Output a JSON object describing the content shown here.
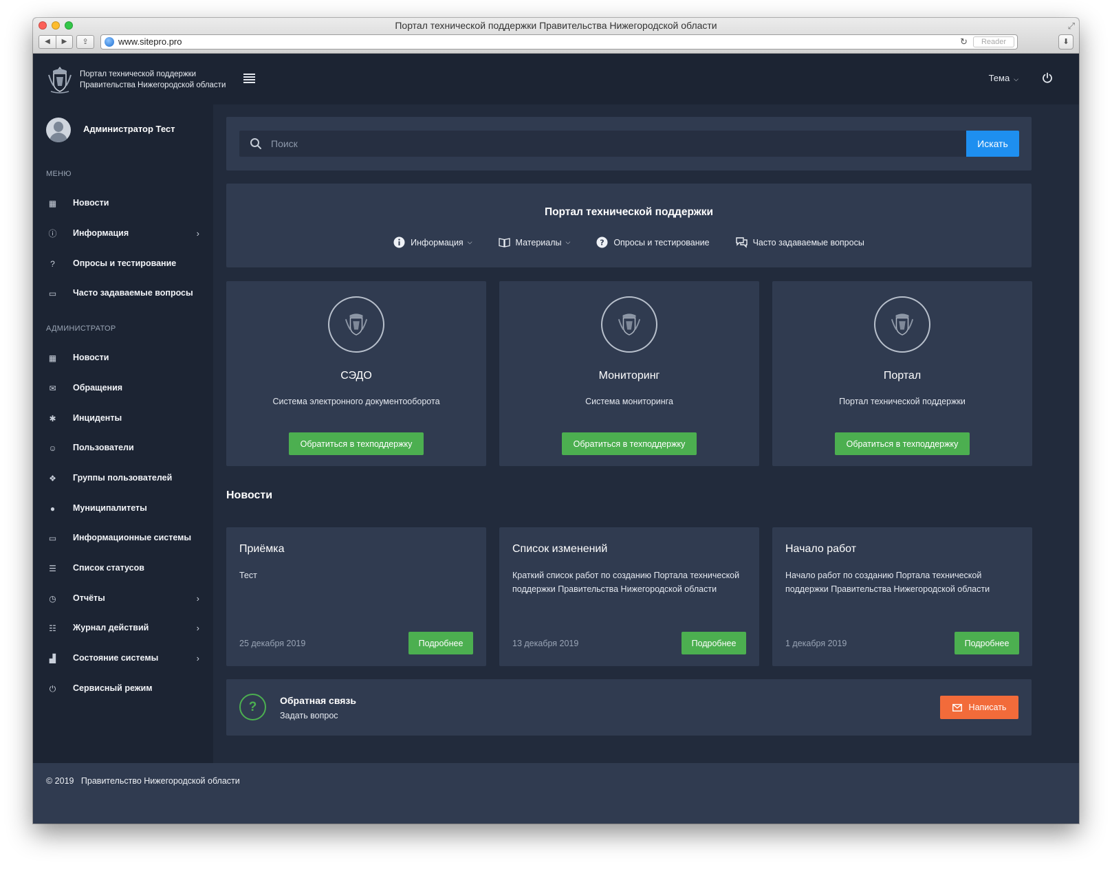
{
  "browser": {
    "window_title": "Портал технической поддержки Правительства Нижегородской области",
    "url": "www.sitepro.pro",
    "reader_label": "Reader"
  },
  "header": {
    "logo_line1": "Портал технической поддержки",
    "logo_line2": "Правительства Нижегородской области",
    "theme_label": "Тема"
  },
  "sidebar": {
    "user_name": "Администратор Тест",
    "menu_label": "МЕНЮ",
    "menu_items": [
      {
        "label": "Новости",
        "icon": "newspaper-icon"
      },
      {
        "label": "Информация",
        "icon": "info-icon",
        "has_submenu": true
      },
      {
        "label": "Опросы и тестирование",
        "icon": "question-icon"
      },
      {
        "label": "Часто задаваемые вопросы",
        "icon": "chat-icon"
      }
    ],
    "admin_label": "АДМИНИСТРАТОР",
    "admin_items": [
      {
        "label": "Новости",
        "icon": "newspaper-icon"
      },
      {
        "label": "Обращения",
        "icon": "envelope-icon"
      },
      {
        "label": "Инциденты",
        "icon": "bug-icon"
      },
      {
        "label": "Пользователи",
        "icon": "user-icon"
      },
      {
        "label": "Группы пользователей",
        "icon": "users-icon"
      },
      {
        "label": "Муниципалитеты",
        "icon": "globe-icon"
      },
      {
        "label": "Информационные системы",
        "icon": "monitor-icon"
      },
      {
        "label": "Список статусов",
        "icon": "list-icon"
      },
      {
        "label": "Отчёты",
        "icon": "clock-icon",
        "has_submenu": true
      },
      {
        "label": "Журнал действий",
        "icon": "checklist-icon",
        "has_submenu": true
      },
      {
        "label": "Состояние системы",
        "icon": "bar-chart-icon",
        "has_submenu": true
      },
      {
        "label": "Сервисный режим",
        "icon": "power-icon"
      }
    ]
  },
  "search": {
    "placeholder": "Поиск",
    "button_label": "Искать"
  },
  "portal": {
    "title": "Портал технической поддержки",
    "nav": [
      {
        "label": "Информация",
        "icon": "info-icon",
        "has_dropdown": true
      },
      {
        "label": "Материалы",
        "icon": "book-icon",
        "has_dropdown": true
      },
      {
        "label": "Опросы и тестирование",
        "icon": "question-icon",
        "has_dropdown": false
      },
      {
        "label": "Часто задаваемые вопросы",
        "icon": "chat-icon",
        "has_dropdown": false
      }
    ]
  },
  "systems": [
    {
      "title": "СЭДО",
      "description": "Система электронного документооборота",
      "button": "Обратиться в техподдержку"
    },
    {
      "title": "Мониторинг",
      "description": "Система мониторинга",
      "button": "Обратиться в техподдержку"
    },
    {
      "title": "Портал",
      "description": "Портал технической поддержки",
      "button": "Обратиться в техподдержку"
    }
  ],
  "news": {
    "heading": "Новости",
    "items": [
      {
        "title": "Приёмка",
        "text": "Тест",
        "date": "25 декабря 2019",
        "button": "Подробнее"
      },
      {
        "title": "Список изменений",
        "text": "Краткий список работ по созданию Портала технической поддержки Правительства Нижегородской области",
        "date": "13 декабря 2019",
        "button": "Подробнее"
      },
      {
        "title": "Начало работ",
        "text": "Начало работ по созданию Портала технической поддержки Правительства Нижегородской области",
        "date": "1 декабря 2019",
        "button": "Подробнее"
      }
    ]
  },
  "feedback": {
    "title": "Обратная связь",
    "subtitle": "Задать вопрос",
    "button_label": "Написать",
    "icon_glyph": "?"
  },
  "footer": {
    "copyright": "© 2019",
    "org": "Правительство Нижегородской области"
  },
  "colors": {
    "background": "#222b3c",
    "panel": "#303b50",
    "sidebar": "#1c2433",
    "primary_blue": "#1e8ff0",
    "success_green": "#4caf50",
    "accent_orange": "#f26b3a"
  }
}
